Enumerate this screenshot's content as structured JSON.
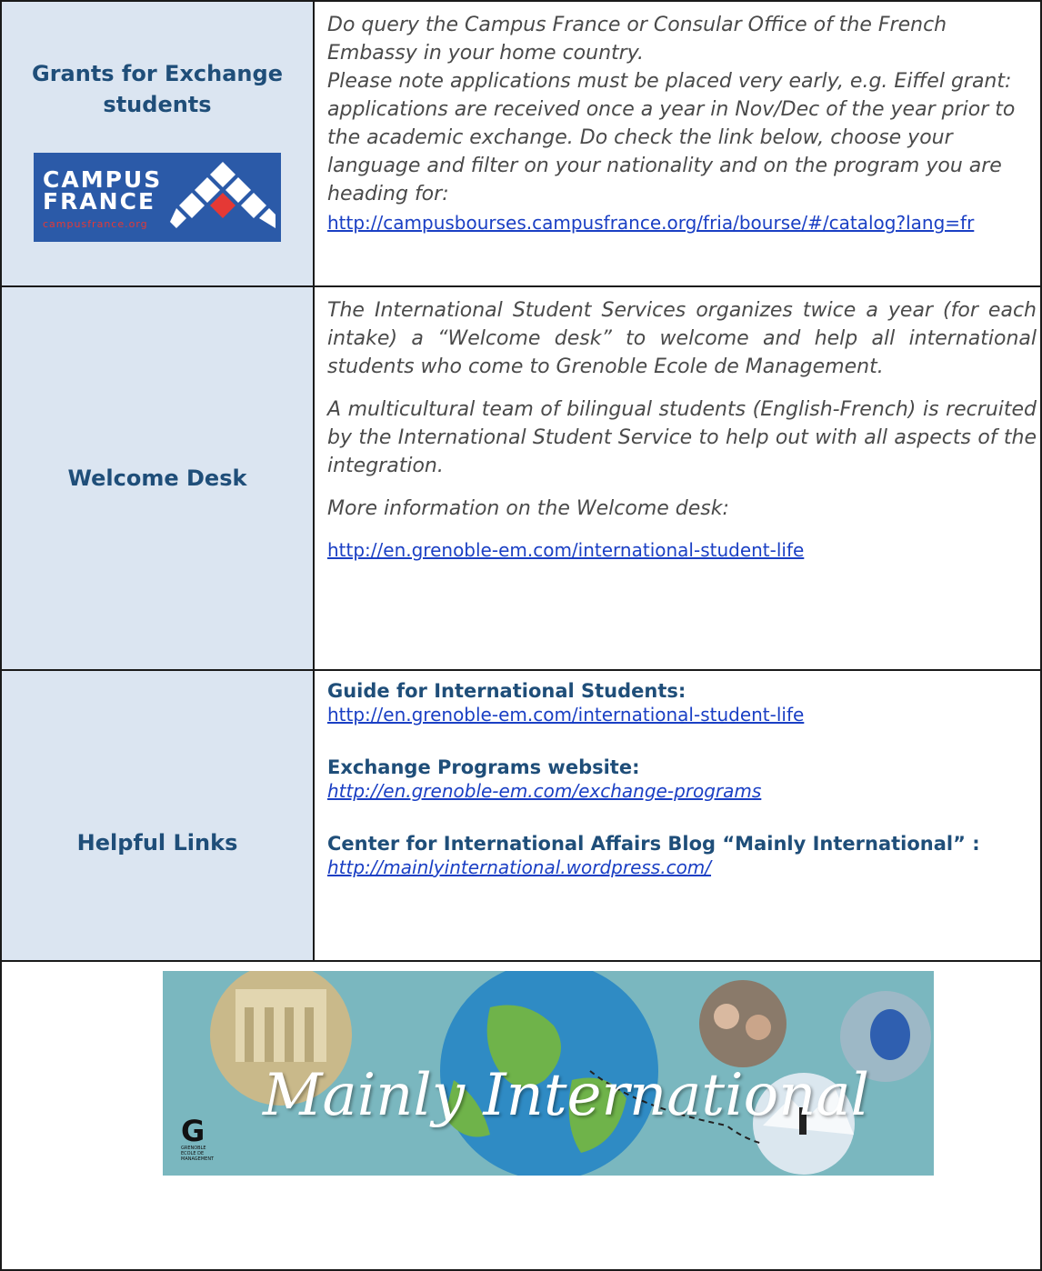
{
  "rows": {
    "grants": {
      "label": "Grants for Exchange students",
      "logo": {
        "word1": "CAMPUS",
        "word2": "FRANCE",
        "url": "campusfrance.org",
        "colors": {
          "background": "#2b5aa8",
          "accent": "#e53935",
          "text": "#ffffff"
        }
      },
      "paragraph1": "Do query the Campus France or Consular Office of the French Embassy in your home country.",
      "paragraph2": "Please note applications must be placed very early, e.g. Eiffel grant: applications are received once a year in Nov/Dec of the year prior to the academic exchange. Do check the link below, choose your language and filter on your nationality and on the program you are heading for:",
      "link": "http://campusbourses.campusfrance.org/fria/bourse/#/catalog?lang=fr"
    },
    "welcome": {
      "label": "Welcome Desk",
      "paragraph1": "The International Student Services organizes twice a year (for each intake) a “Welcome desk” to welcome and help all international students who come to Grenoble Ecole de Management.",
      "paragraph2": "A multicultural team of bilingual students (English-French) is recruited by the International Student Service to help out with all aspects of the integration.",
      "paragraph3": "More information on the Welcome desk:",
      "link": "http://en.grenoble-em.com/international-student-life"
    },
    "helpful": {
      "label": "Helpful Links",
      "items": [
        {
          "heading": "Guide for International Students:",
          "link": "http://en.grenoble-em.com/international-student-life"
        },
        {
          "heading": "Exchange Programs website:",
          "link": "http://en.grenoble-em.com/exchange-programs"
        },
        {
          "heading": "Center for International Affairs Blog  “Mainly International” :",
          "link": "http://mainlyinternational.wordpress.com/"
        }
      ]
    }
  },
  "banner": {
    "title": "Mainly International",
    "logo_letter": "G",
    "logo_text": "GRENOBLE ECOLE DE MANAGEMENT",
    "background_color": "#7ab7bf"
  },
  "colors": {
    "label_bg": "#dbe5f1",
    "label_text": "#1f4e79",
    "link": "#1a3fc4",
    "body_text": "#4a4a4a"
  }
}
